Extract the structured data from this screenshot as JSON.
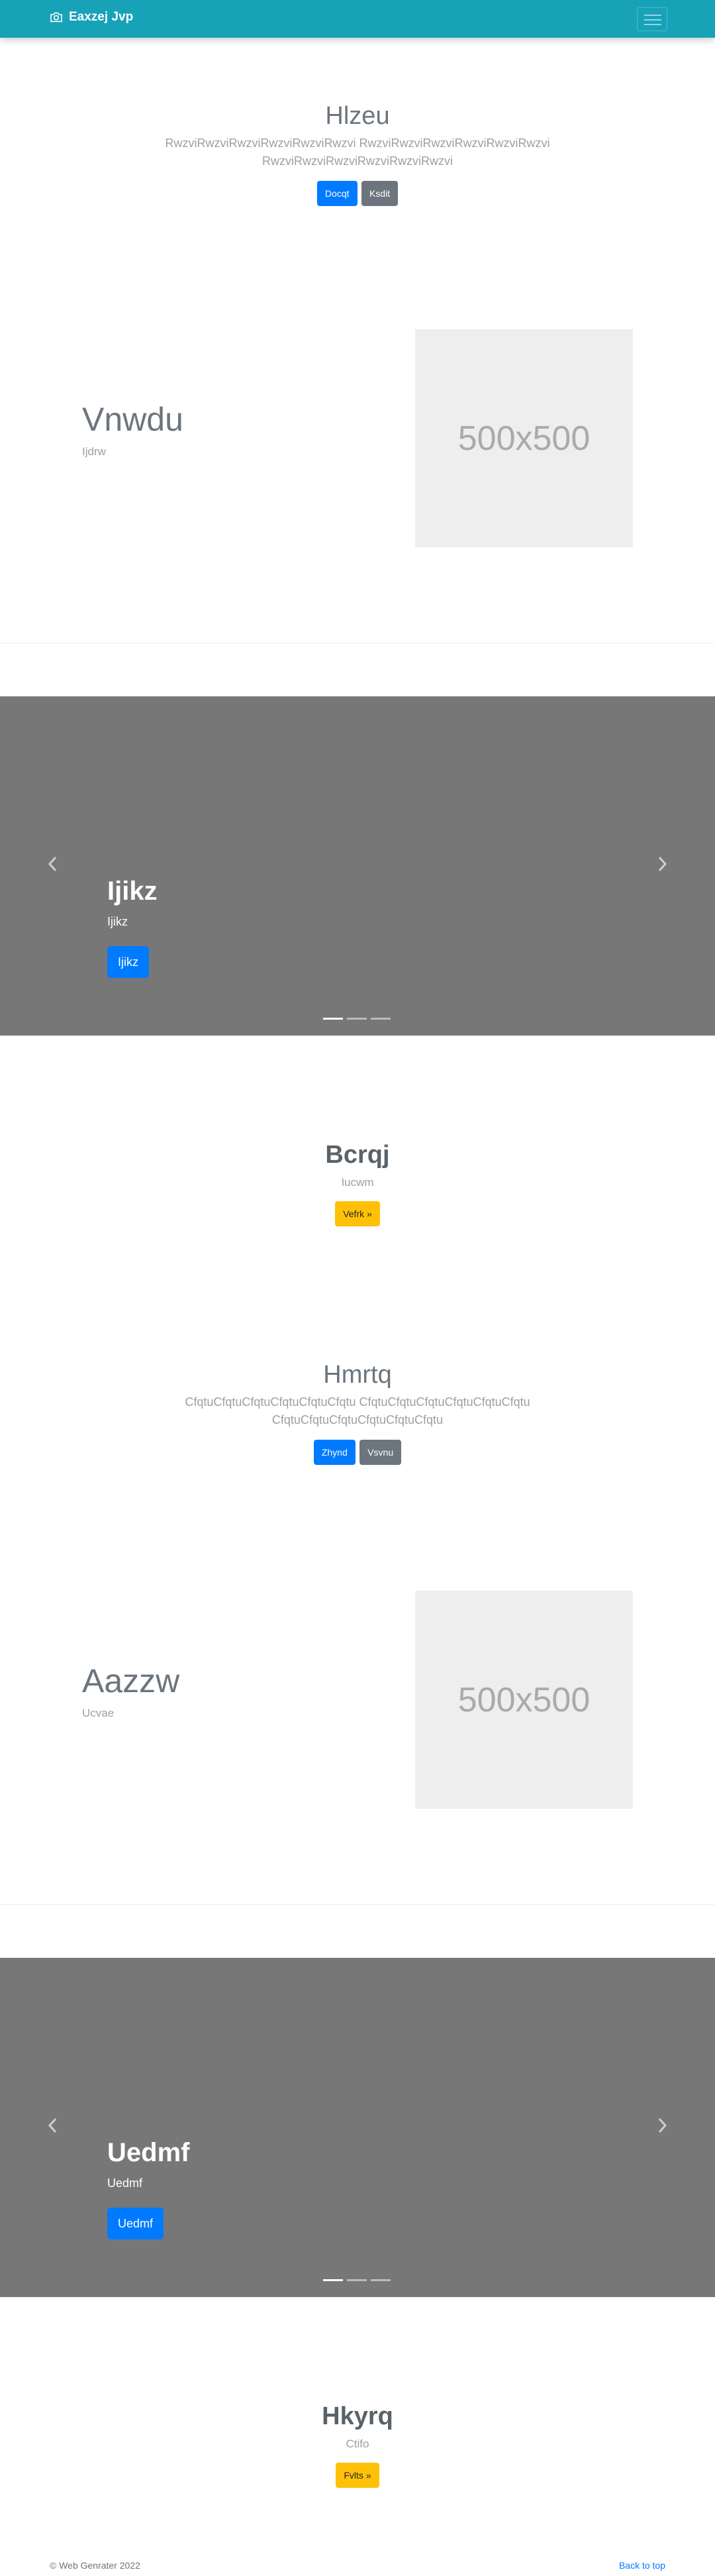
{
  "navbar": {
    "brand": "Eaxzej Jvp",
    "bg": "#17a2b8"
  },
  "jumbotron1": {
    "title": "Hlzeu",
    "lead_line1": "RwzviRwzviRwzviRwzviRwzviRwzvi RwzviRwzviRwzviRwzviRwzviRwzvi",
    "lead_line2": "RwzviRwzviRwzviRwzviRwzviRwzvi",
    "primary": "Docqt",
    "secondary": "Ksdit"
  },
  "feature1": {
    "title": "Vnwdu",
    "subtitle": "Ijdrw",
    "image_label": "500x500"
  },
  "carousel1": {
    "title": "Ijikz",
    "subtitle": "Ijikz",
    "button": "Ijikz",
    "slides": 3,
    "active": 0
  },
  "callout1": {
    "title": "Bcrqj",
    "subtitle": "Iucwm",
    "button": "Vefrk »"
  },
  "jumbotron2": {
    "title": "Hmrtq",
    "lead_line1": "CfqtuCfqtuCfqtuCfqtuCfqtuCfqtu CfqtuCfqtuCfqtuCfqtuCfqtuCfqtu",
    "lead_line2": "CfqtuCfqtuCfqtuCfqtuCfqtuCfqtu",
    "primary": "Zhynd",
    "secondary": "Vsvnu"
  },
  "feature2": {
    "title": "Aazzw",
    "subtitle": "Ucvae",
    "image_label": "500x500"
  },
  "carousel2": {
    "title": "Uedmf",
    "subtitle": "Uedmf",
    "button": "Uedmf",
    "slides": 3,
    "active": 0
  },
  "callout2": {
    "title": "Hkyrq",
    "subtitle": "Ctifo",
    "button": "Fvlts »"
  },
  "footer": {
    "copyright": "© Web Genrater 2022",
    "back_to_top": "Back to top"
  }
}
